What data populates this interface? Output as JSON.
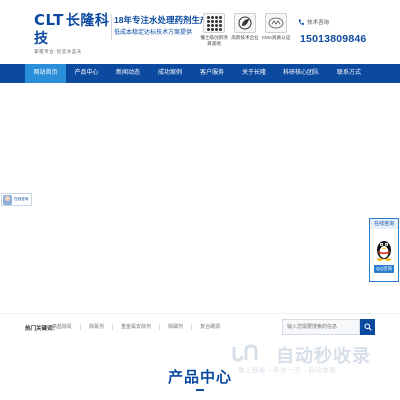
{
  "brand": {
    "logo_latin": "CLT",
    "logo_cn": "长隆科技",
    "logo_sub": "掌握专业·创造水蓝天",
    "slogan_main": "18年专注水处理药剂生产",
    "slogan_sub": "低成本稳定达标技术方案提供"
  },
  "certs": [
    {
      "icon": "grid-icon",
      "label_1": "懂士级创新项",
      "label_2": "目基地"
    },
    {
      "icon": "leaf-icon",
      "label_1": "高新技术企业",
      "label_2": ""
    },
    {
      "icon": "cma-icon",
      "label_1": "CMA资质认证",
      "label_2": ""
    }
  ],
  "contact": {
    "label": "技术咨询",
    "phone": "15013809846"
  },
  "nav": {
    "items": [
      {
        "label": "网站首页",
        "active": true
      },
      {
        "label": "产品中心",
        "active": false
      },
      {
        "label": "新闻动态",
        "active": false
      },
      {
        "label": "成功案例",
        "active": false
      },
      {
        "label": "客户服务",
        "active": false
      },
      {
        "label": "关于长隆",
        "active": false
      },
      {
        "label": "科研核心团队",
        "active": false
      },
      {
        "label": "联系方式",
        "active": false
      }
    ]
  },
  "float_left": {
    "label": "在线咨询"
  },
  "qq_box": {
    "title": "在线咨询",
    "button": "QQ咨询"
  },
  "hotbar": {
    "title": "热门关键词：",
    "links": [
      "高盐除氮",
      "除氟剂",
      "重金属去除剂",
      "除磷剂",
      "复合碳源"
    ],
    "search_placeholder": "输入您需要搜索的信息"
  },
  "section": {
    "title": "产品中心"
  },
  "watermark": {
    "main": "自动秒收录",
    "sub": "做上链接→来访一次→自动收录"
  },
  "colors": {
    "primary": "#0c4aa0",
    "nav_active": "#2a8ed8"
  }
}
